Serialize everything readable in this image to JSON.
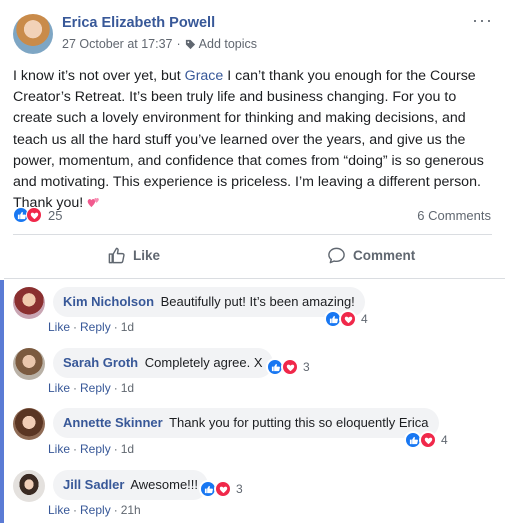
{
  "post": {
    "author": "Erica Elizabeth Powell",
    "timestamp": "27 October at 17:37",
    "separator": "·",
    "add_topics": "Add topics",
    "more_label": "···",
    "text_before": "I know it’s not over yet, but ",
    "mention": "Grace",
    "text_after": " I can’t thank you enough for the Course Creator’s Retreat. It’s been truly life and business changing. For you to create such a lovely environment for thinking and making decisions, and teach us all the hard stuff you’ve learned over the years, and give us the power, momentum, and confidence that comes from “doing” is so generous and motivating. This experience is priceless. I’m leaving a different person. Thank you! ",
    "reaction_count": "25",
    "comments_count": "6 Comments",
    "like_label": "Like",
    "comment_label": "Comment"
  },
  "comments": [
    {
      "name": "Kim Nicholson",
      "text": "Beautifully put! It’s been amazing!",
      "reactions": "4",
      "like": "Like",
      "reply": "Reply",
      "time": "1d",
      "sep": "·"
    },
    {
      "name": "Sarah Groth",
      "text": "Completely agree. X",
      "reactions": "3",
      "like": "Like",
      "reply": "Reply",
      "time": "1d",
      "sep": "·"
    },
    {
      "name": "Annette Skinner",
      "text": "Thank you for putting this so eloquently Erica",
      "reactions": "4",
      "like": "Like",
      "reply": "Reply",
      "time": "1d",
      "sep": "·"
    },
    {
      "name": "Jill Sadler",
      "text": "Awesome!!!",
      "reactions": "3",
      "like": "Like",
      "reply": "Reply",
      "time": "21h",
      "sep": "·"
    }
  ],
  "colors": {
    "link": "#385898",
    "like_reaction": "#1877f2",
    "love_reaction": "#f0284a",
    "comment_bubble": "#f2f3f5",
    "comments_rail": "#5b7bd5"
  },
  "icons": {
    "tag": "tag-icon",
    "more": "more-options-icon",
    "like": "thumbs-up-icon",
    "comment": "speech-bubble-icon",
    "love": "heart-icon",
    "emoji": "two-hearts-emoji"
  }
}
